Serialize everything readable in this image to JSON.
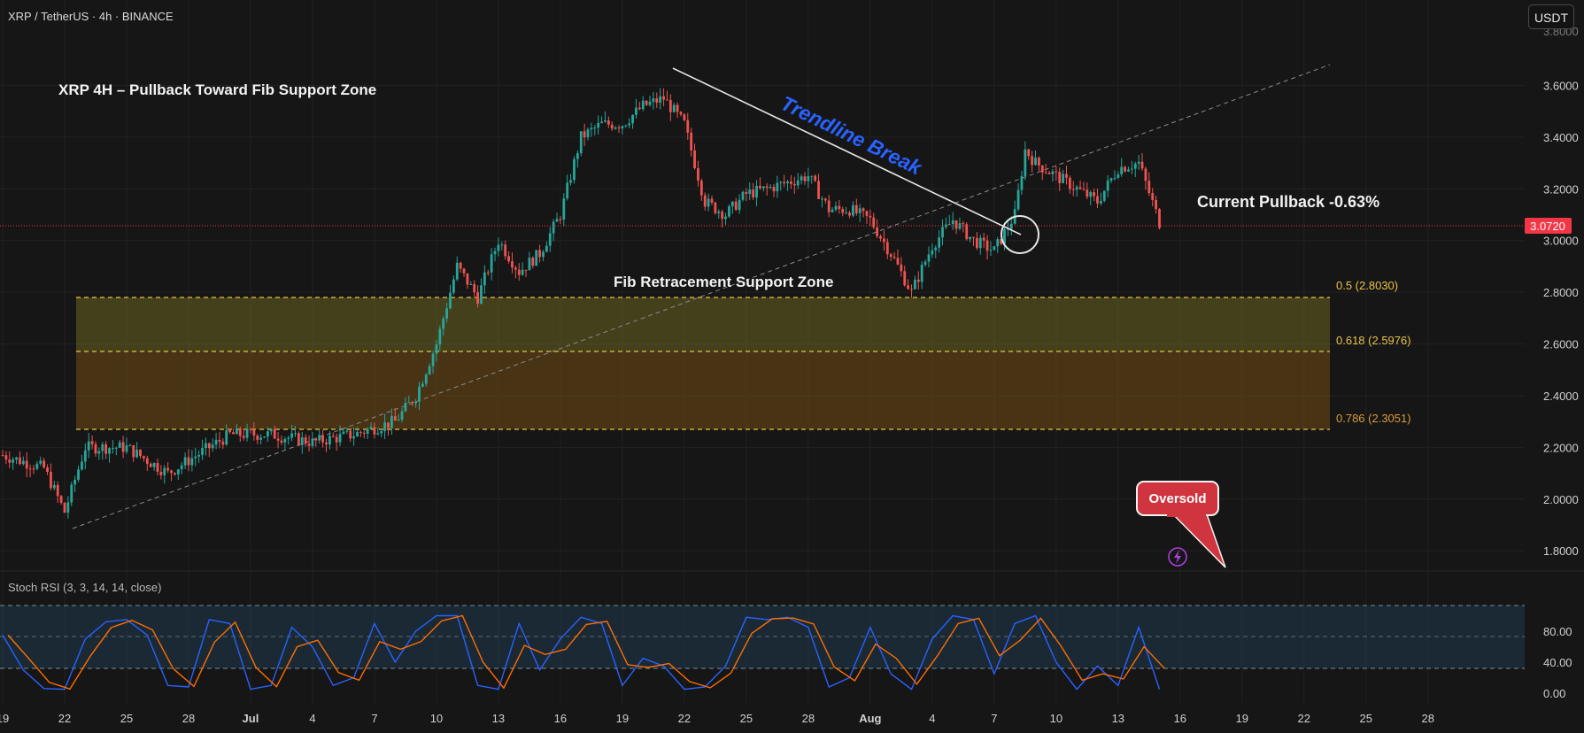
{
  "header": {
    "symbol_line": "XRP / TetherUS · 4h · BINANCE",
    "currency_button": "USDT"
  },
  "annotations": {
    "title": "XRP 4H – Pullback Toward Fib Support Zone",
    "trendline_break": "Trendline Break",
    "fib_zone": "Fib Retracement Support Zone",
    "current_pullback": "Current Pullback -0.63%",
    "oversold_callout": "Oversold"
  },
  "price_axis": {
    "ticks": [
      "3.6000",
      "3.4000",
      "3.2000",
      "3.0000",
      "2.8000",
      "2.6000",
      "2.4000",
      "2.2000",
      "2.0000",
      "1.8000"
    ],
    "current_price_label": "3.0720",
    "top_partial_tick": "3.8000"
  },
  "stoch_axis": {
    "ticks": [
      "80.00",
      "40.00",
      "0.00"
    ]
  },
  "time_axis": {
    "labels": [
      "19",
      "22",
      "25",
      "28",
      "Jul",
      "4",
      "7",
      "10",
      "13",
      "16",
      "19",
      "22",
      "25",
      "28",
      "Aug",
      "4",
      "7",
      "10",
      "13",
      "16",
      "19",
      "22",
      "25",
      "28"
    ]
  },
  "fib_levels": [
    {
      "ratio_label": "0.5 (2.8030)",
      "price": 2.803,
      "color": "#e8c24a"
    },
    {
      "ratio_label": "0.618 (2.5976)",
      "price": 2.5976,
      "color": "#e8c24a"
    },
    {
      "ratio_label": "0.786 (2.3051)",
      "price": 2.3051,
      "color": "#d99a3a"
    }
  ],
  "indicator": {
    "label": "Stoch RSI (3, 3, 14, 14, close)",
    "upper_band": 80,
    "middle_band": 50,
    "lower_band": 20
  },
  "colors": {
    "up": "#26a69a",
    "down": "#ef5350",
    "trendline_label": "#2962ff",
    "k_line": "#2962ff",
    "d_line": "#ff6d00",
    "price_line": "#f23645",
    "oversold_box": "#d0343f"
  },
  "chart_data": {
    "type": "candlestick",
    "symbol": "XRP / TetherUS",
    "interval": "4h",
    "exchange": "BINANCE",
    "last_price": 3.072,
    "ylim": [
      1.8,
      3.8
    ],
    "price_anchors": [
      {
        "date": "Jun 19",
        "price": 2.17
      },
      {
        "date": "Jun 21",
        "price": 2.12
      },
      {
        "date": "Jun 22",
        "price": 1.95
      },
      {
        "date": "Jun 23",
        "price": 2.2
      },
      {
        "date": "Jun 25",
        "price": 2.2
      },
      {
        "date": "Jun 27",
        "price": 2.1
      },
      {
        "date": "Jun 29",
        "price": 2.2
      },
      {
        "date": "Jun 30",
        "price": 2.25
      },
      {
        "date": "Jul 2",
        "price": 2.25
      },
      {
        "date": "Jul 4",
        "price": 2.22
      },
      {
        "date": "Jul 6",
        "price": 2.25
      },
      {
        "date": "Jul 8",
        "price": 2.3
      },
      {
        "date": "Jul 9",
        "price": 2.4
      },
      {
        "date": "Jul 10",
        "price": 2.6
      },
      {
        "date": "Jul 11",
        "price": 2.9
      },
      {
        "date": "Jul 12",
        "price": 2.78
      },
      {
        "date": "Jul 13",
        "price": 3.0
      },
      {
        "date": "Jul 14",
        "price": 2.88
      },
      {
        "date": "Jul 15",
        "price": 2.95
      },
      {
        "date": "Jul 16",
        "price": 3.1
      },
      {
        "date": "Jul 17",
        "price": 3.4
      },
      {
        "date": "Jul 18",
        "price": 3.45
      },
      {
        "date": "Jul 19",
        "price": 3.45
      },
      {
        "date": "Jul 20",
        "price": 3.52
      },
      {
        "date": "Jul 21",
        "price": 3.55
      },
      {
        "date": "Jul 22",
        "price": 3.45
      },
      {
        "date": "Jul 23",
        "price": 3.15
      },
      {
        "date": "Jul 24",
        "price": 3.1
      },
      {
        "date": "Jul 25",
        "price": 3.18
      },
      {
        "date": "Jul 26",
        "price": 3.2
      },
      {
        "date": "Jul 28",
        "price": 3.25
      },
      {
        "date": "Jul 29",
        "price": 3.12
      },
      {
        "date": "Jul 30",
        "price": 3.12
      },
      {
        "date": "Jul 31",
        "price": 3.08
      },
      {
        "date": "Aug 1",
        "price": 2.95
      },
      {
        "date": "Aug 2",
        "price": 2.8
      },
      {
        "date": "Aug 3",
        "price": 2.98
      },
      {
        "date": "Aug 4",
        "price": 3.08
      },
      {
        "date": "Aug 5",
        "price": 3.0
      },
      {
        "date": "Aug 6",
        "price": 2.96
      },
      {
        "date": "Aug 7",
        "price": 3.1
      },
      {
        "date": "Aug 7 PM",
        "price": 3.35
      },
      {
        "date": "Aug 8",
        "price": 3.3
      },
      {
        "date": "Aug 9",
        "price": 3.25
      },
      {
        "date": "Aug 10",
        "price": 3.2
      },
      {
        "date": "Aug 11",
        "price": 3.15
      },
      {
        "date": "Aug 12",
        "price": 3.28
      },
      {
        "date": "Aug 13",
        "price": 3.3
      },
      {
        "date": "Aug 14",
        "price": 3.07
      }
    ],
    "trendlines": [
      {
        "name": "descending",
        "from": {
          "date": "Jul 21",
          "price": 3.66
        },
        "to": {
          "date": "Aug 7",
          "price": 3.03
        }
      },
      {
        "name": "ascending",
        "from": {
          "date": "Jun 22",
          "price": 1.93
        },
        "to": {
          "date": "Aug 21",
          "price": 3.67
        }
      }
    ],
    "stoch_rsi_anchors": [
      {
        "date": "Jun 19",
        "k": 75
      },
      {
        "date": "Jun 20",
        "k": 30
      },
      {
        "date": "Jun 21",
        "k": 6
      },
      {
        "date": "Jun 22",
        "k": 5
      },
      {
        "date": "Jun 23",
        "k": 70
      },
      {
        "date": "Jun 24",
        "k": 92
      },
      {
        "date": "Jun 25",
        "k": 95
      },
      {
        "date": "Jun 26",
        "k": 75
      },
      {
        "date": "Jun 27",
        "k": 10
      },
      {
        "date": "Jun 28",
        "k": 8
      },
      {
        "date": "Jun 29",
        "k": 95
      },
      {
        "date": "Jun 30",
        "k": 90
      },
      {
        "date": "Jul 1",
        "k": 5
      },
      {
        "date": "Jul 2",
        "k": 10
      },
      {
        "date": "Jul 3",
        "k": 85
      },
      {
        "date": "Jul 4",
        "k": 60
      },
      {
        "date": "Jul 5",
        "k": 10
      },
      {
        "date": "Jul 6",
        "k": 20
      },
      {
        "date": "Jul 7",
        "k": 90
      },
      {
        "date": "Jul 8",
        "k": 40
      },
      {
        "date": "Jul 9",
        "k": 80
      },
      {
        "date": "Jul 10",
        "k": 100
      },
      {
        "date": "Jul 11",
        "k": 100
      },
      {
        "date": "Jul 12",
        "k": 10
      },
      {
        "date": "Jul 13",
        "k": 5
      },
      {
        "date": "Jul 14",
        "k": 90
      },
      {
        "date": "Jul 15",
        "k": 30
      },
      {
        "date": "Jul 16",
        "k": 70
      },
      {
        "date": "Jul 17",
        "k": 98
      },
      {
        "date": "Jul 18",
        "k": 90
      },
      {
        "date": "Jul 19",
        "k": 10
      },
      {
        "date": "Jul 20",
        "k": 45
      },
      {
        "date": "Jul 21",
        "k": 35
      },
      {
        "date": "Jul 22",
        "k": 5
      },
      {
        "date": "Jul 23",
        "k": 8
      },
      {
        "date": "Jul 24",
        "k": 35
      },
      {
        "date": "Jul 25",
        "k": 98
      },
      {
        "date": "Jul 26",
        "k": 95
      },
      {
        "date": "Jul 27",
        "k": 98
      },
      {
        "date": "Jul 28",
        "k": 85
      },
      {
        "date": "Jul 29",
        "k": 8
      },
      {
        "date": "Jul 30",
        "k": 20
      },
      {
        "date": "Jul 31",
        "k": 85
      },
      {
        "date": "Aug 1",
        "k": 25
      },
      {
        "date": "Aug 2",
        "k": 5
      },
      {
        "date": "Aug 3",
        "k": 70
      },
      {
        "date": "Aug 4",
        "k": 100
      },
      {
        "date": "Aug 5",
        "k": 95
      },
      {
        "date": "Aug 6",
        "k": 25
      },
      {
        "date": "Aug 7",
        "k": 90
      },
      {
        "date": "Aug 8",
        "k": 100
      },
      {
        "date": "Aug 9",
        "k": 40
      },
      {
        "date": "Aug 10",
        "k": 5
      },
      {
        "date": "Aug 11",
        "k": 35
      },
      {
        "date": "Aug 12",
        "k": 10
      },
      {
        "date": "Aug 13",
        "k": 85
      },
      {
        "date": "Aug 14",
        "k": 5
      }
    ]
  }
}
